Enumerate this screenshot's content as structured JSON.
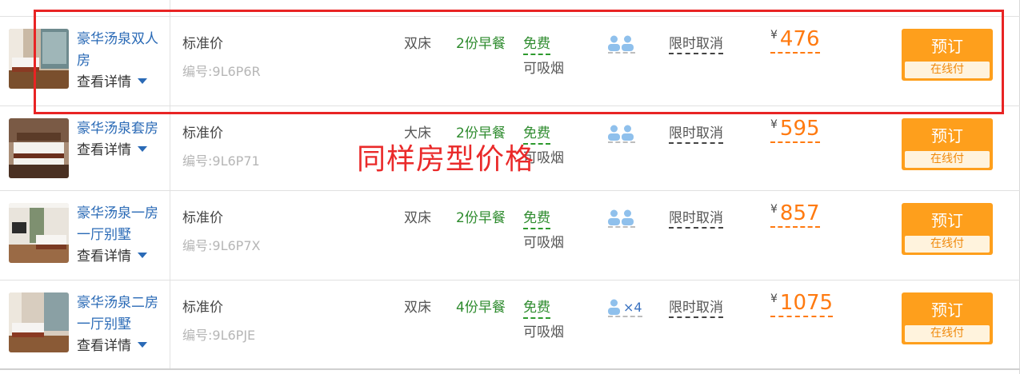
{
  "rooms": [
    {
      "name": "豪华汤泉双人房",
      "detail": "查看详情",
      "rate_type": "标准价",
      "code": "编号:9L6P6R",
      "bed": "双床",
      "breakfast": "2份早餐",
      "wifi": "免费",
      "smoking": "可吸烟",
      "guests_icon": "two-person-icon",
      "guests_count": "",
      "cancel": "限时取消",
      "currency": "¥",
      "price": "476",
      "book_label": "预订",
      "pay_label": "在线付"
    },
    {
      "name": "豪华汤泉套房",
      "detail": "查看详情",
      "rate_type": "标准价",
      "code": "编号:9L6P71",
      "bed": "大床",
      "breakfast": "2份早餐",
      "wifi": "免费",
      "smoking": "可吸烟",
      "guests_icon": "two-person-icon",
      "guests_count": "",
      "cancel": "限时取消",
      "currency": "¥",
      "price": "595",
      "book_label": "预订",
      "pay_label": "在线付"
    },
    {
      "name": "豪华汤泉一房一厅别墅",
      "detail": "查看详情",
      "rate_type": "标准价",
      "code": "编号:9L6P7X",
      "bed": "双床",
      "breakfast": "2份早餐",
      "wifi": "免费",
      "smoking": "可吸烟",
      "guests_icon": "two-person-icon",
      "guests_count": "",
      "cancel": "限时取消",
      "currency": "¥",
      "price": "857",
      "book_label": "预订",
      "pay_label": "在线付"
    },
    {
      "name": "豪华汤泉二房一厅别墅",
      "detail": "查看详情",
      "rate_type": "标准价",
      "code": "编号:9L6PJE",
      "bed": "双床",
      "breakfast": "4份早餐",
      "wifi": "免费",
      "smoking": "可吸烟",
      "guests_icon": "person-icon",
      "guests_count": "×4",
      "cancel": "限时取消",
      "currency": "¥",
      "price": "1075",
      "book_label": "预订",
      "pay_label": "在线付"
    }
  ],
  "annotation": "同样房型价格",
  "colors": {
    "link": "#2a6ab6",
    "price": "#ff7a10",
    "book_button": "#fe9f1c",
    "breakfast": "#2e8b2e",
    "annotation": "#ea2a2a"
  }
}
